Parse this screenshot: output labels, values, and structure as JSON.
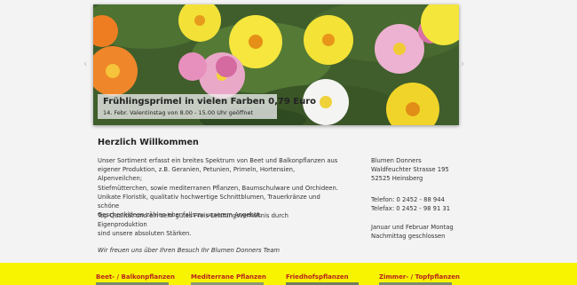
{
  "slider": {
    "caption_title": "Frühlingsprimel in vielen Farben 0,79 Euro",
    "caption_subtitle": "14. Febr. Valentinstag von 8.00 - 15.00 Uhr geöffnet",
    "prev_arrow": "‹",
    "next_arrow": "›"
  },
  "main": {
    "heading": "Herzlich Willkommen",
    "intro_lines": [
      "Unser Sortiment erfasst ein breites Spektrum von Beet und Balkonpflanzen aus",
      "eigener Produktion, z.B. Geranien, Petunien, Primeln, Hortensien, Alpenveilchen;",
      "Stiefmütterchen, sowie mediterranen Pflanzen, Baumschulware und Orchideen.",
      "Unikate Floristik, qualitativ hochwertige Schnittblumen, Trauerkränze und schöne",
      "Geschenkideen zählen ebenfalls zu unserem Angebot."
    ],
    "quality_lines": [
      "Top Qualität und ein sehr gutes Preis-Leistungsverhältnis durch Eigenproduktion",
      "sind unsere absoluten Stärken."
    ],
    "welcome_text": "Wir freuen uns über Ihren Besuch Ihr Blumen Donners Team"
  },
  "contact": {
    "name": "Blumen Donners",
    "street": "Waldfeuchter Strasse 195",
    "city": "52525 Heinsberg",
    "phone": "Telefon: 0 2452 - 88 944",
    "fax": "Telefax: 0 2452 - 98 91 31",
    "hours_line1": "Januar und Februar Montag",
    "hours_line2": "Nachmittag geschlossen"
  },
  "footer": {
    "categories": [
      "Beet- / Balkonpflanzen",
      "Mediterrane Pflanzen",
      "Friedhofspflanzen",
      "Zimmer- / Topfpflanzen"
    ]
  },
  "colors": {
    "footer_bg": "#f8f400",
    "category_text": "#b7231a",
    "page_bg": "#f3f3f3"
  }
}
